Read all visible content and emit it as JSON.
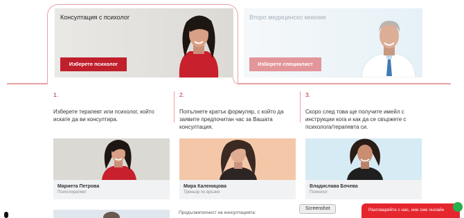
{
  "tabs": {
    "active": {
      "title": "Консултация с психолог",
      "button": "Изберете психолог"
    },
    "inactive": {
      "title": "Второ медицинско мнение",
      "button": "Изберете специалист"
    }
  },
  "steps": [
    {
      "num": "1.",
      "text": "Изберете терапевт или психолог, който искате да ви консултира."
    },
    {
      "num": "2.",
      "text": "Попълнете кратък формуляр, с който да заявите предпочитан час за Вашата консултация."
    },
    {
      "num": "3.",
      "text": "Скоро след това ще получите имейл с инструкции кога и как да се свържете с психолога/терапевта си."
    }
  ],
  "specialists": [
    {
      "name": "Мариета Петрова",
      "role": "Психотерапевт"
    },
    {
      "name": "Мира Каленицова",
      "role": "Треньор по връзки"
    },
    {
      "name": "Владислава Бочева",
      "role": "Психолог"
    }
  ],
  "duration_label": "Продължителност на консултацията:",
  "screenshot_tip": "Screenshot",
  "chat": {
    "label": "Разговаряйте с нас, ние сме онлайн"
  },
  "colors": {
    "brand": "#c0202c",
    "brand_light": "#e3969a",
    "chat_red": "#e5262e",
    "online_green": "#27b04c"
  }
}
